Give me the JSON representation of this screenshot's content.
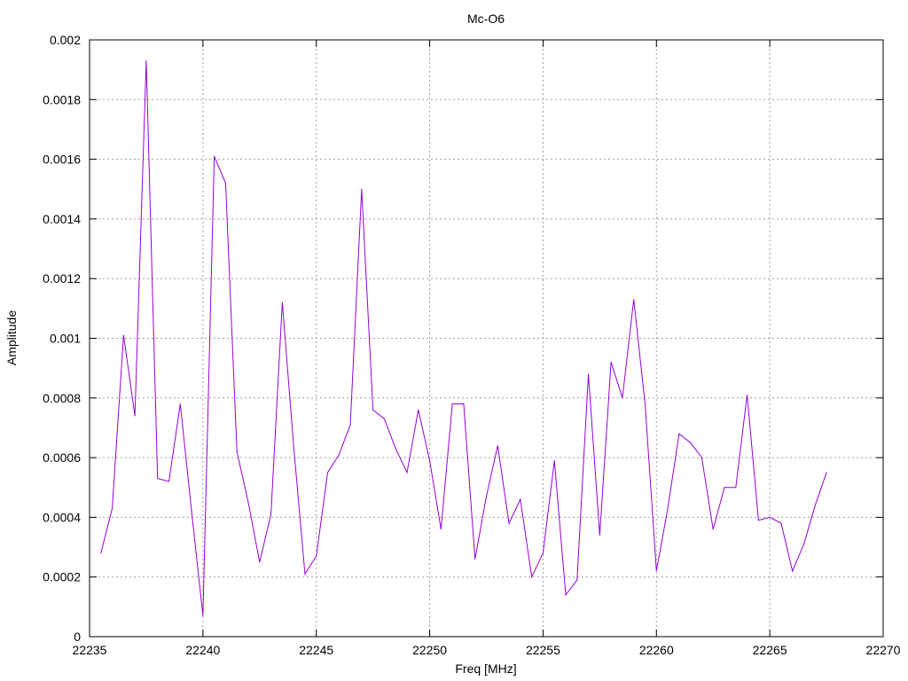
{
  "chart_data": {
    "type": "line",
    "title": "Mc-O6",
    "xlabel": "Freq [MHz]",
    "ylabel": "Amplitude",
    "xlim": [
      22235,
      22270
    ],
    "ylim": [
      0,
      0.002
    ],
    "grid": true,
    "legend": "none",
    "line_color": "#9400d3",
    "xticks": [
      22235,
      22240,
      22245,
      22250,
      22255,
      22260,
      22265,
      22270
    ],
    "xtick_labels": [
      "22235",
      "22240",
      "22245",
      "22250",
      "22255",
      "22260",
      "22265",
      "22270"
    ],
    "yticks": [
      0,
      0.0002,
      0.0004,
      0.0006,
      0.0008,
      0.001,
      0.0012,
      0.0014,
      0.0016,
      0.0018,
      0.002
    ],
    "ytick_labels": [
      "0",
      "0.0002",
      "0.0004",
      "0.0006",
      "0.0008",
      "0.001",
      "0.0012",
      "0.0014",
      "0.0016",
      "0.0018",
      "0.002"
    ],
    "series": [
      {
        "x": [
          22235.5,
          22236.0,
          22236.5,
          22237.0,
          22237.5,
          22238.0,
          22238.5,
          22239.0,
          22239.5,
          22240.0,
          22240.5,
          22241.0,
          22241.5,
          22242.0,
          22242.5,
          22243.0,
          22243.5,
          22244.0,
          22244.5,
          22245.0,
          22245.5,
          22246.0,
          22246.5,
          22247.0,
          22247.5,
          22248.0,
          22248.5,
          22249.0,
          22249.5,
          22250.0,
          22250.5,
          22251.0,
          22251.5,
          22252.0,
          22252.5,
          22253.0,
          22253.5,
          22254.0,
          22254.5,
          22255.0,
          22255.5,
          22256.0,
          22256.5,
          22257.0,
          22257.5,
          22258.0,
          22258.5,
          22259.0,
          22259.5,
          22260.0,
          22260.5,
          22261.0,
          22261.5,
          22262.0,
          22262.5,
          22263.0,
          22263.5,
          22264.0,
          22264.5,
          22265.0,
          22265.5,
          22266.0,
          22266.5,
          22267.0,
          22267.5
        ],
        "y": [
          0.00028,
          0.00043,
          0.00101,
          0.00074,
          0.00193,
          0.00053,
          0.00052,
          0.00078,
          0.00042,
          7e-05,
          0.00161,
          0.00152,
          0.00062,
          0.00045,
          0.00025,
          0.00041,
          0.00112,
          0.00064,
          0.00021,
          0.00027,
          0.00055,
          0.00061,
          0.00071,
          0.0015,
          0.00076,
          0.00073,
          0.00063,
          0.00055,
          0.00076,
          0.00059,
          0.00036,
          0.00078,
          0.00078,
          0.00026,
          0.00047,
          0.00064,
          0.00038,
          0.00046,
          0.0002,
          0.00028,
          0.00059,
          0.00014,
          0.00019,
          0.00088,
          0.00034,
          0.00092,
          0.0008,
          0.00113,
          0.00078,
          0.00022,
          0.00043,
          0.00068,
          0.00065,
          0.0006,
          0.00036,
          0.0005,
          0.0005,
          0.00081,
          0.00039,
          0.0004,
          0.00038,
          0.00022,
          0.00031,
          0.00044,
          0.00055
        ]
      }
    ]
  }
}
